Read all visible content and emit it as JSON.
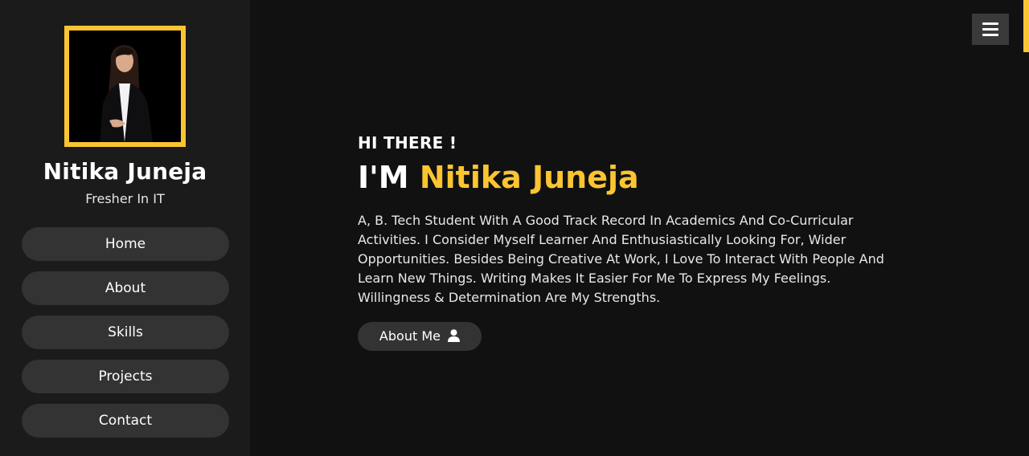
{
  "sidebar": {
    "profile": {
      "name": "Nitika Juneja",
      "role": "Fresher In IT"
    },
    "nav": [
      {
        "label": "Home"
      },
      {
        "label": "About"
      },
      {
        "label": "Skills"
      },
      {
        "label": "Projects"
      },
      {
        "label": "Contact"
      }
    ]
  },
  "hero": {
    "greeting": "HI THERE !",
    "headline_prefix": "I'M",
    "headline_name": "Nitika Juneja",
    "intro": "A, B. Tech Student With A Good Track Record In Academics And Co-Curricular Activities. I Consider Myself Learner And Enthusiastically Looking For, Wider Opportunities. Besides Being Creative At Work, I Love To Interact With People And Learn New Things. Writing Makes It Easier For Me To Express My Feelings. Willingness & Determination Are My Strengths.",
    "cta_label": "About Me"
  },
  "icons": {
    "menu": "hamburger-icon",
    "cta": "user-icon"
  },
  "colors": {
    "accent": "#fbc531",
    "sidebar_bg": "#1b1b1b",
    "main_bg": "#111111",
    "button_bg": "#333333"
  }
}
